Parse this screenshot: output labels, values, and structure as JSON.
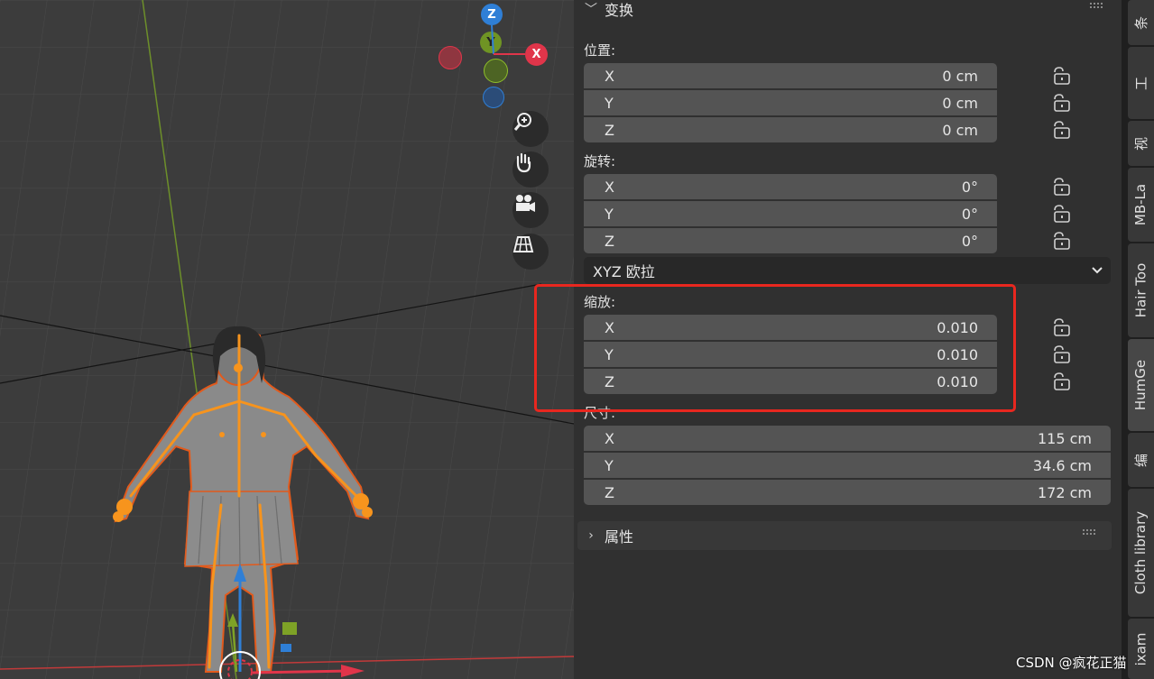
{
  "gizmo": {
    "z_label": "Z",
    "y_label": "Y",
    "x_label": "X"
  },
  "transform_panel": {
    "title": "变换",
    "location": {
      "label": "位置:",
      "rows": [
        {
          "axis": "X",
          "value": "0 cm"
        },
        {
          "axis": "Y",
          "value": "0 cm"
        },
        {
          "axis": "Z",
          "value": "0 cm"
        }
      ]
    },
    "rotation": {
      "label": "旋转:",
      "rows": [
        {
          "axis": "X",
          "value": "0°"
        },
        {
          "axis": "Y",
          "value": "0°"
        },
        {
          "axis": "Z",
          "value": "0°"
        }
      ],
      "mode": "XYZ 欧拉"
    },
    "scale": {
      "label": "缩放:",
      "rows": [
        {
          "axis": "X",
          "value": "0.010"
        },
        {
          "axis": "Y",
          "value": "0.010"
        },
        {
          "axis": "Z",
          "value": "0.010"
        }
      ]
    },
    "dimensions": {
      "label": "尺寸:",
      "rows": [
        {
          "axis": "X",
          "value": "115 cm"
        },
        {
          "axis": "Y",
          "value": "34.6 cm"
        },
        {
          "axis": "Z",
          "value": "172 cm"
        }
      ]
    }
  },
  "properties_panel": {
    "title": "属性"
  },
  "tabs": [
    {
      "label": "条"
    },
    {
      "label": "工"
    },
    {
      "label": "视"
    },
    {
      "label": "MB-La"
    },
    {
      "label": "Hair Too"
    },
    {
      "label": "HumGe"
    },
    {
      "label": "编"
    },
    {
      "label": "Cloth library"
    },
    {
      "label": "ixam"
    }
  ],
  "watermark": "CSDN @疯花正猫",
  "colors": {
    "accent_highlight": "#e8271f",
    "axis_x": "#e0354a",
    "axis_y": "#7ea226",
    "axis_z": "#2f7fd6",
    "armature": "#f7941d"
  }
}
